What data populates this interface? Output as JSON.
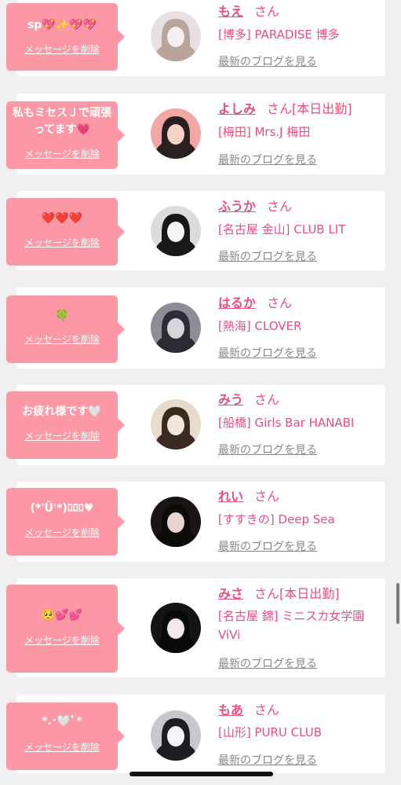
{
  "entries": [
    {
      "message": "sp💖✨💖💖",
      "delete_label": "メッセージを削除",
      "name": "もえ",
      "honorific": "さん",
      "shop": "[博多] PARADISE 博多",
      "blog_link": "最新のブログを見る",
      "avatar_colors": [
        "#e6e0e4",
        "#b8a49a",
        "#f3eef0"
      ]
    },
    {
      "message": "私もミセスＪで頑張ってます💗",
      "delete_label": "メッセージを削除",
      "name": "よしみ",
      "honorific": "さん",
      "status": "[本日出勤]",
      "shop": "[梅田] Mrs.J 梅田",
      "blog_link": "最新のブログを見る",
      "avatar_colors": [
        "#f3a6a6",
        "#2a2020",
        "#f6d2c4"
      ]
    },
    {
      "message": "❤️❤️❤️",
      "delete_label": "メッセージを削除",
      "name": "ふうか",
      "honorific": "さん",
      "shop": "[名古屋 金山] CLUB LIT",
      "blog_link": "最新のブログを見る",
      "avatar_colors": [
        "#dcdcdc",
        "#181818",
        "#f5f5f5"
      ]
    },
    {
      "message": "🍀",
      "delete_label": "メッセージを削除",
      "name": "はるか",
      "honorific": "さん",
      "shop": "[熱海] CLOVER",
      "blog_link": "最新のブログを見る",
      "avatar_colors": [
        "#8d8d98",
        "#2c2c34",
        "#d8d6dc"
      ]
    },
    {
      "message": "お疲れ様です🤍",
      "delete_label": "メッセージを削除",
      "name": "みう",
      "honorific": "さん",
      "shop": "[船橋] Girls Bar HANABI",
      "blog_link": "最新のブログを見る",
      "avatar_colors": [
        "#e7dccb",
        "#3b2a22",
        "#f1e6dc"
      ]
    },
    {
      "message": "(*'Ü'*)ﾛﾛﾛ♥",
      "delete_label": "メッセージを削除",
      "name": "れい",
      "honorific": "さん",
      "shop": "[すすきの] Deep Sea",
      "blog_link": "最新のブログを見る",
      "avatar_colors": [
        "#1a1414",
        "#0d0a0a",
        "#e8d4d0"
      ]
    },
    {
      "message": "🥺💕💕",
      "delete_label": "メッセージを削除",
      "name": "みさ",
      "honorific": "さん",
      "status": "[本日出勤]",
      "shop": "[名古屋 錦] ミニスカ女学園ViVi",
      "blog_link": "最新のブログを見る",
      "avatar_colors": [
        "#141414",
        "#0a0a0a",
        "#f2e8ec"
      ]
    },
    {
      "message": "*.･🤍ﾟ*",
      "delete_label": "メッセージを削除",
      "name": "もあ",
      "honorific": "さん",
      "shop": "[山形] PURU CLUB",
      "blog_link": "最新のブログを見る",
      "avatar_colors": [
        "#c8c8cc",
        "#1e1e22",
        "#f4f4f6"
      ]
    }
  ]
}
